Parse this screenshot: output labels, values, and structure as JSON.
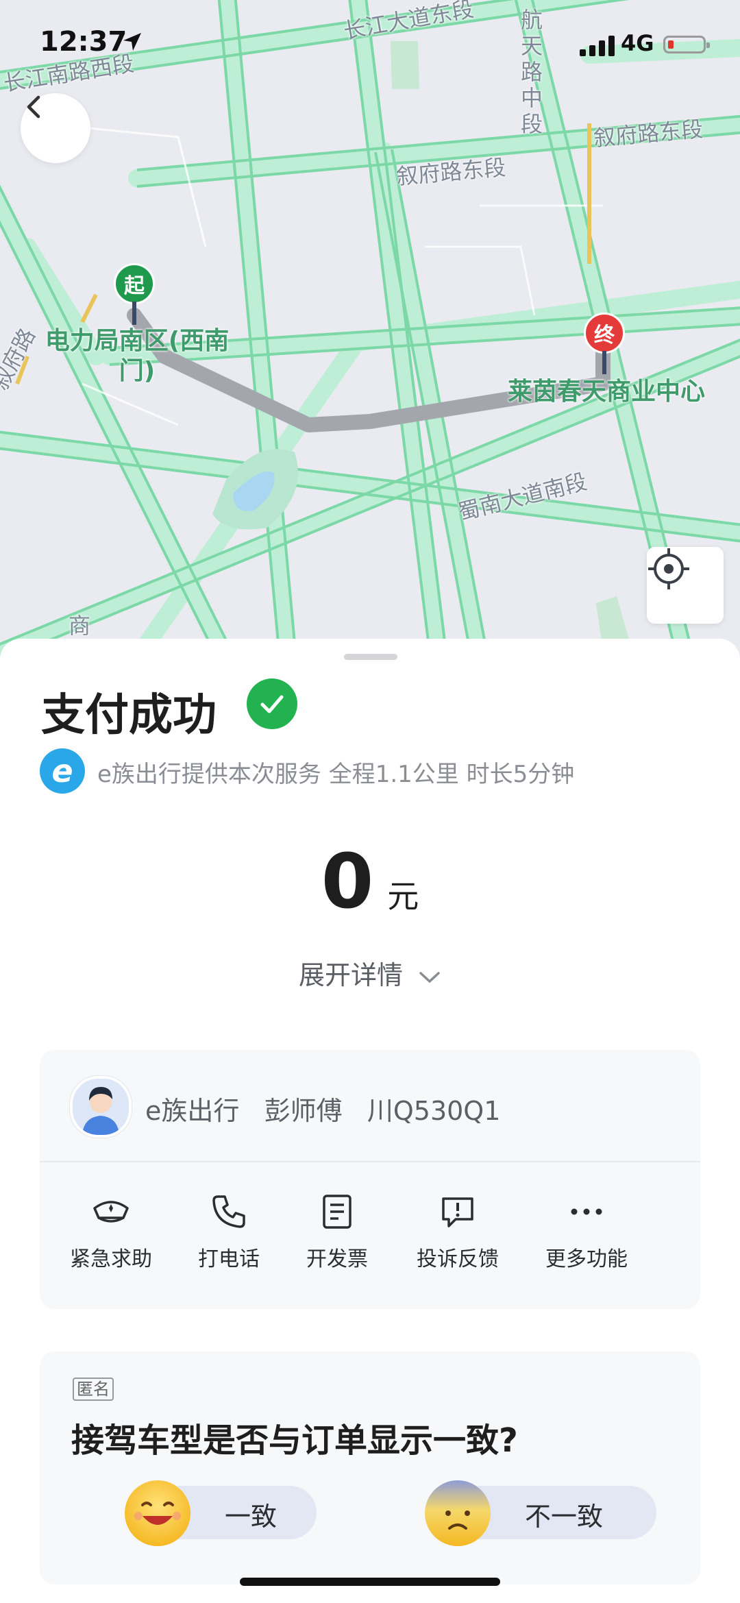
{
  "status_bar": {
    "time": "12:37",
    "network": "4G"
  },
  "map": {
    "roads": [
      "长江大道东段",
      "长江南路西段",
      "航天路中段",
      "叙府路东段",
      "叙府路东段",
      "叙府路",
      "蜀南大道南段",
      "商"
    ],
    "start_marker": "起",
    "start_label": "电力局南区(西南门)",
    "end_marker": "终",
    "end_label": "莱茵春天商业中心",
    "colors": {
      "road": "#9ee2bf",
      "route": "#a9abb3",
      "start": "#1f9a4d",
      "end": "#e53a3a"
    }
  },
  "status": {
    "title": "支付成功"
  },
  "service": {
    "logo_letter": "e",
    "text": "e族出行提供本次服务 全程1.1公里 时长5分钟"
  },
  "fare": {
    "amount": "0",
    "unit": "元",
    "details_label": "展开详情"
  },
  "driver": {
    "info": "e族出行   彭师傅   川Q530Q1"
  },
  "actions": [
    {
      "label": "紧急求助",
      "icon": "police-hat-icon"
    },
    {
      "label": "打电话",
      "icon": "phone-icon"
    },
    {
      "label": "开发票",
      "icon": "invoice-icon"
    },
    {
      "label": "投诉反馈",
      "icon": "complaint-icon"
    },
    {
      "label": "更多功能",
      "icon": "more-icon"
    }
  ],
  "survey": {
    "tag": "匿名",
    "question": "接驾车型是否与订单显示一致?",
    "options": [
      {
        "label": "一致",
        "icon": "happy-face-icon"
      },
      {
        "label": "不一致",
        "icon": "sad-face-icon"
      }
    ]
  }
}
